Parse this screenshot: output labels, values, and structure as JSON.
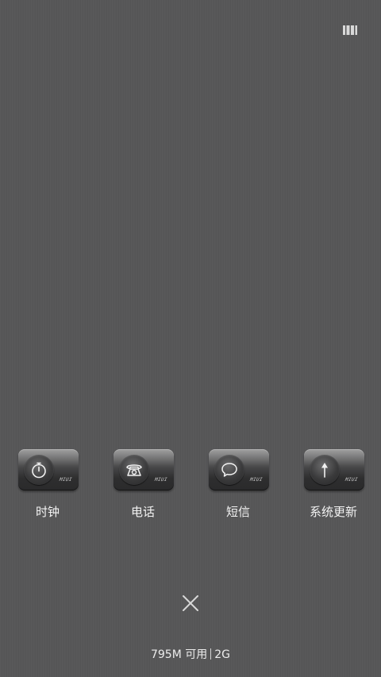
{
  "apps": [
    {
      "id": "clock",
      "label": "时钟",
      "icon": "stopwatch-icon"
    },
    {
      "id": "phone",
      "label": "电话",
      "icon": "telephone-icon"
    },
    {
      "id": "messages",
      "label": "短信",
      "icon": "speech-bubble-icon"
    },
    {
      "id": "system_update",
      "label": "系统更新",
      "icon": "up-arrow-icon"
    }
  ],
  "tile_brand": "MIUI",
  "top_right_icon": "grid-layout-icon",
  "close_icon": "close-icon",
  "memory": {
    "available": "795M 可用",
    "total": "2G"
  }
}
